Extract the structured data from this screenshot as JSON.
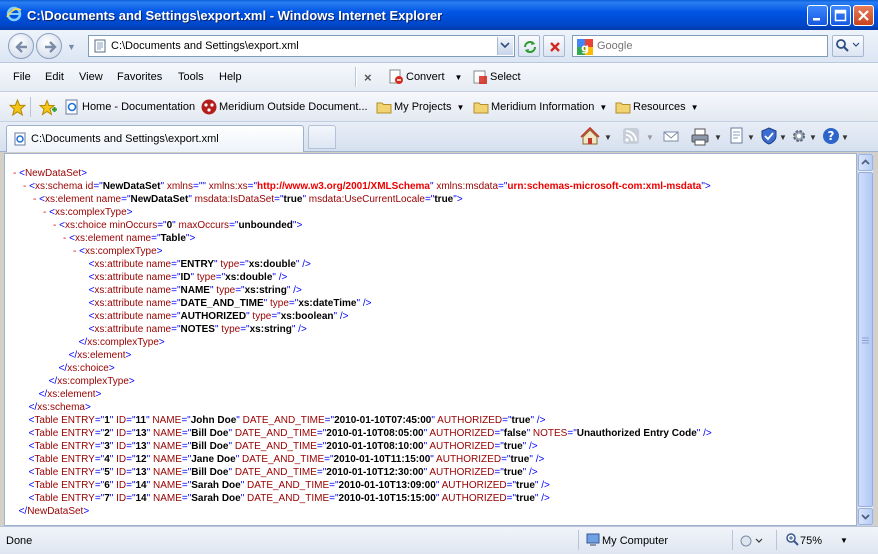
{
  "window": {
    "title": "C:\\Documents and Settings\\export.xml - Windows Internet Explorer"
  },
  "address": {
    "url": "C:\\Documents and Settings\\export.xml",
    "search_placeholder": "Google"
  },
  "menu": {
    "items": [
      "File",
      "Edit",
      "View",
      "Favorites",
      "Tools",
      "Help"
    ],
    "convert_label": "Convert",
    "select_label": "Select"
  },
  "favorites": {
    "items": [
      {
        "label": "Home - Documentation",
        "icon": "ie-page-icon"
      },
      {
        "label": "Meridium Outside Document...",
        "icon": "meridium-logo-icon"
      },
      {
        "label": "My Projects",
        "icon": "folder-icon"
      },
      {
        "label": "Meridium Information",
        "icon": "folder-icon"
      },
      {
        "label": "Resources",
        "icon": "folder-icon"
      }
    ]
  },
  "tab": {
    "label": "C:\\Documents and Settings\\export.xml"
  },
  "xml": {
    "root": "NewDataSet",
    "schema": {
      "id": "NewDataSet",
      "xmlns": "",
      "xmlns_xs": "http://www.w3.org/2001/XMLSchema",
      "xmlns_msdata": "urn:schemas-microsoft-com:xml-msdata"
    },
    "element": {
      "name": "NewDataSet",
      "isdataset": "true",
      "usecurrentlocale": "true"
    },
    "choice": {
      "minOccurs": "0",
      "maxOccurs": "unbounded"
    },
    "table_element": "Table",
    "attributes": [
      {
        "name": "ENTRY",
        "type": "xs:double"
      },
      {
        "name": "ID",
        "type": "xs:double"
      },
      {
        "name": "NAME",
        "type": "xs:string"
      },
      {
        "name": "DATE_AND_TIME",
        "type": "xs:dateTime"
      },
      {
        "name": "AUTHORIZED",
        "type": "xs:boolean"
      },
      {
        "name": "NOTES",
        "type": "xs:string"
      }
    ],
    "rows": [
      {
        "ENTRY": "1",
        "ID": "11",
        "NAME": "John Doe",
        "DATE_AND_TIME": "2010-01-10T07:45:00",
        "AUTHORIZED": "true",
        "NOTES": null
      },
      {
        "ENTRY": "2",
        "ID": "13",
        "NAME": "Bill Doe",
        "DATE_AND_TIME": "2010-01-10T08:05:00",
        "AUTHORIZED": "false",
        "NOTES": "Unauthorized Entry Code"
      },
      {
        "ENTRY": "3",
        "ID": "13",
        "NAME": "Bill Doe",
        "DATE_AND_TIME": "2010-01-10T08:10:00",
        "AUTHORIZED": "true",
        "NOTES": null
      },
      {
        "ENTRY": "4",
        "ID": "12",
        "NAME": "Jane Doe",
        "DATE_AND_TIME": "2010-01-10T11:15:00",
        "AUTHORIZED": "true",
        "NOTES": null
      },
      {
        "ENTRY": "5",
        "ID": "13",
        "NAME": "Bill Doe",
        "DATE_AND_TIME": "2010-01-10T12:30:00",
        "AUTHORIZED": "true",
        "NOTES": null
      },
      {
        "ENTRY": "6",
        "ID": "14",
        "NAME": "Sarah Doe",
        "DATE_AND_TIME": "2010-01-10T13:09:00",
        "AUTHORIZED": "true",
        "NOTES": null
      },
      {
        "ENTRY": "7",
        "ID": "14",
        "NAME": "Sarah Doe",
        "DATE_AND_TIME": "2010-01-10T15:15:00",
        "AUTHORIZED": "true",
        "NOTES": null
      }
    ]
  },
  "status": {
    "left": "Done",
    "zone": "My Computer",
    "zoom": "75%"
  },
  "colors": {
    "titlebar": "#0055e5",
    "xml_markup": "#0000ff",
    "xml_name": "#990000",
    "xml_toggle": "#ee0000"
  }
}
